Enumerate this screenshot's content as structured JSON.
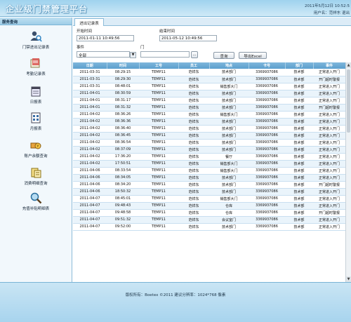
{
  "header": {
    "title": "企业级门禁管理平台",
    "date": "2011年5月12日 10:52:5",
    "user_label": "用户名：范祥东 退出"
  },
  "sidebar": {
    "heading": "服务查询",
    "items": [
      {
        "label": "门禁进出记录表",
        "icon": "person-search-icon"
      },
      {
        "label": "考勤记录表",
        "icon": "timecard-icon"
      },
      {
        "label": "日报表",
        "icon": "daily-report-icon"
      },
      {
        "label": "月报表",
        "icon": "monthly-report-icon"
      },
      {
        "label": "账户余额查询",
        "icon": "account-balance-icon"
      },
      {
        "label": "消费明细查询",
        "icon": "consumption-detail-icon"
      },
      {
        "label": "充值补贴明细表",
        "icon": "magnifier-icon"
      }
    ]
  },
  "tab": {
    "label": "进出记录表"
  },
  "filters": {
    "start_label": "开始时间",
    "start_value": "2011-01-11 10:49:56",
    "end_label": "结束时间",
    "end_value": "2011-05-12 10:49:56",
    "event_label": "事件",
    "event_value": "全部",
    "door_label": "门",
    "door_value": "",
    "browse_label": "...",
    "query_label": "查询",
    "export_label": "导出Excel"
  },
  "table": {
    "columns": [
      "日期",
      "时间",
      "工号",
      "员工",
      "地点",
      "卡号",
      "部门",
      "事件"
    ],
    "rows": [
      [
        "2011-03-31",
        "08:29:15",
        "TEMP11",
        "范祥东",
        "技术部门",
        "3369937086",
        "技术部",
        "正常进入开门"
      ],
      [
        "2011-03-31",
        "08:29:30",
        "TEMP11",
        "范祥东",
        "技术部门",
        "3369937086",
        "技术部",
        "开门超时警报"
      ],
      [
        "2011-03-31",
        "08:48:01",
        "TEMP11",
        "范祥东",
        "销售部大门",
        "3369937086",
        "技术部",
        "正常进入开门"
      ],
      [
        "2011-04-01",
        "08:30:59",
        "TEMP11",
        "范祥东",
        "技术部门",
        "3369937086",
        "技术部",
        "正常进入开门"
      ],
      [
        "2011-04-01",
        "08:31:17",
        "TEMP11",
        "范祥东",
        "技术部门",
        "3369937086",
        "技术部",
        "正常进入开门"
      ],
      [
        "2011-04-01",
        "08:31:32",
        "TEMP11",
        "范祥东",
        "技术部门",
        "3369937086",
        "技术部",
        "开门超时警报"
      ],
      [
        "2011-04-02",
        "08:36:26",
        "TEMP11",
        "范祥东",
        "销售部大门",
        "3369937086",
        "技术部",
        "正常进入开门"
      ],
      [
        "2011-04-02",
        "08:36:36",
        "TEMP11",
        "范祥东",
        "技术部门",
        "3369937086",
        "技术部",
        "正常进入开门"
      ],
      [
        "2011-04-02",
        "08:36:40",
        "TEMP11",
        "范祥东",
        "技术部门",
        "3369937086",
        "技术部",
        "正常进入开门"
      ],
      [
        "2011-04-02",
        "08:36:45",
        "TEMP11",
        "范祥东",
        "技术部门",
        "3369937086",
        "技术部",
        "正常进入开门"
      ],
      [
        "2011-04-02",
        "08:36:54",
        "TEMP11",
        "范祥东",
        "技术部门",
        "3369937086",
        "技术部",
        "正常进入开门"
      ],
      [
        "2011-04-02",
        "08:37:09",
        "TEMP11",
        "范祥东",
        "技术部门",
        "3369937086",
        "技术部",
        "正常进入开门"
      ],
      [
        "2011-04-02",
        "17:36:20",
        "TEMP11",
        "范祥东",
        "餐厅",
        "3369937086",
        "技术部",
        "正常进入开门"
      ],
      [
        "2011-04-02",
        "17:50:51",
        "TEMP11",
        "范祥东",
        "销售部大门",
        "3369937086",
        "技术部",
        "正常进入开门"
      ],
      [
        "2011-04-06",
        "08:33:54",
        "TEMP11",
        "范祥东",
        "销售部大门",
        "3369937086",
        "技术部",
        "正常进入开门"
      ],
      [
        "2011-04-06",
        "08:34:05",
        "TEMP11",
        "范祥东",
        "技术部门",
        "3369937086",
        "技术部",
        "正常进入开门"
      ],
      [
        "2011-04-06",
        "08:34:20",
        "TEMP11",
        "范祥东",
        "技术部门",
        "3369937086",
        "技术部",
        "开门超时警报"
      ],
      [
        "2011-04-06",
        "18:50:32",
        "TEMP11",
        "范祥东",
        "技术部门",
        "3369937086",
        "技术部",
        "正常进入开门"
      ],
      [
        "2011-04-07",
        "08:45:01",
        "TEMP11",
        "范祥东",
        "销售部大门",
        "3369937086",
        "技术部",
        "正常进入开门"
      ],
      [
        "2011-04-07",
        "09:48:43",
        "TEMP11",
        "范祥东",
        "仓库",
        "3369937086",
        "技术部",
        "正常进入开门"
      ],
      [
        "2011-04-07",
        "09:48:58",
        "TEMP11",
        "范祥东",
        "仓库",
        "3369937086",
        "技术部",
        "开门超时警报"
      ],
      [
        "2011-04-07",
        "09:51:32",
        "TEMP11",
        "范祥东",
        "会议室门",
        "3369937086",
        "技术部",
        "正常进入开门"
      ],
      [
        "2011-04-07",
        "09:52:00",
        "TEMP11",
        "范祥东",
        "技术部门",
        "3369937086",
        "技术部",
        "正常进入开门"
      ]
    ]
  },
  "footer": {
    "text": "版权所有：Boetex ©2011   建议分辨率：1024*768 像素"
  }
}
